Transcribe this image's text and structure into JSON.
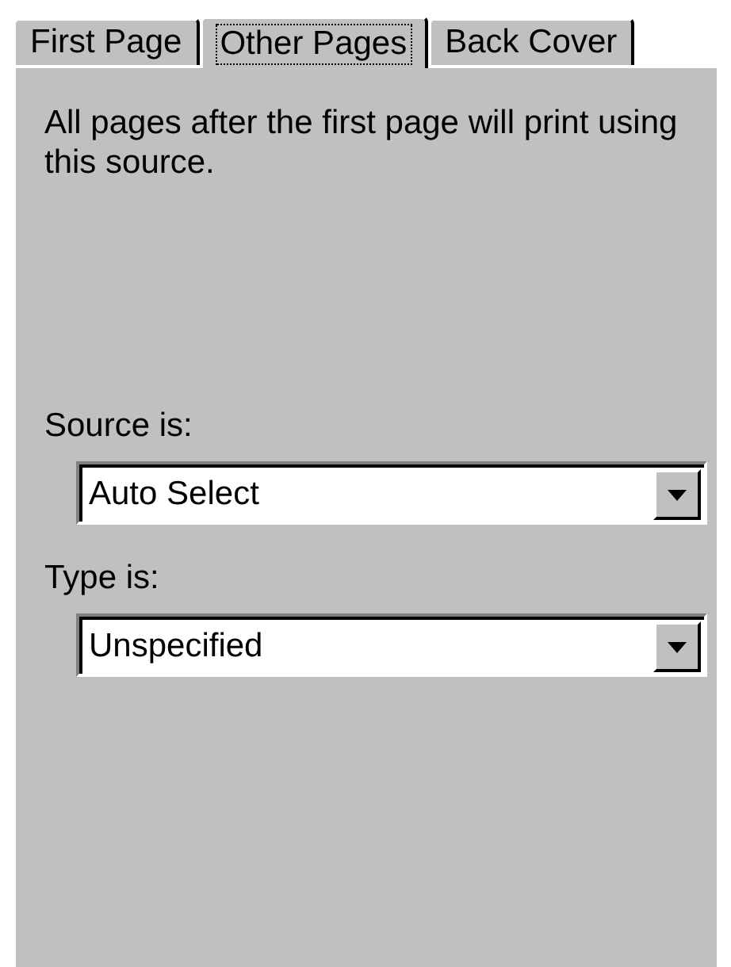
{
  "tabs": [
    {
      "label": "First Page",
      "selected": false
    },
    {
      "label": "Other Pages",
      "selected": true
    },
    {
      "label": "Back Cover",
      "selected": false
    }
  ],
  "description": "All pages after the first page will print using this source.",
  "fields": [
    {
      "label": "Source is:",
      "value": "Auto Select"
    },
    {
      "label": "Type is:",
      "value": "Unspecified"
    }
  ]
}
